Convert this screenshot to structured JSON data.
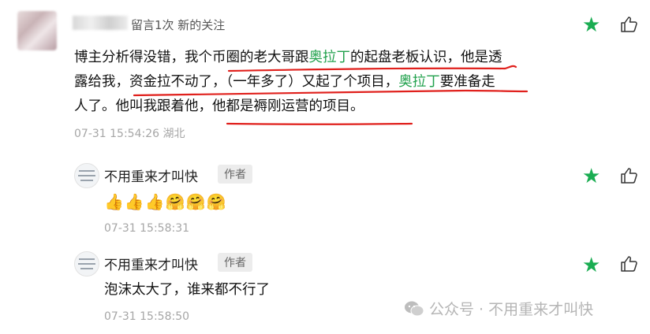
{
  "top_comment": {
    "meta": "留言1次 新的关注",
    "line1": [
      {
        "t": "博主分析得没错，我个币圈的老大哥跟",
        "c": "n"
      },
      {
        "t": "奥拉丁",
        "c": "g"
      },
      {
        "t": "的起盘老板认识，他是透",
        "c": "n"
      }
    ],
    "line2": [
      {
        "t": "露给我，资金拉不动了，（一年多了）又起了个项目，",
        "c": "n"
      },
      {
        "t": "奥拉丁",
        "c": "g"
      },
      {
        "t": "要准备走",
        "c": "n"
      }
    ],
    "line3": "人了。他叫我跟着他，他都是褥刚运营的项目。",
    "time": "07-31 15:54:26 湖北"
  },
  "replies": [
    {
      "name": "不用重来才叫快",
      "tag": "作者",
      "text": "👍👍👍🤗🤗🤗",
      "time": "07-31 15:58:31"
    },
    {
      "name": "不用重来才叫快",
      "tag": "作者",
      "text": "泡沫太大了，谁来都不行了",
      "time": "07-31 15:58:50"
    }
  ],
  "watermark": "公众号 · 不用重来才叫快",
  "icons": {
    "star": "star-icon",
    "like": "thumbs-up-icon",
    "wechat": "wechat-icon"
  },
  "colors": {
    "green": "#22a14d",
    "star": "#1aad52",
    "underline": "#e0201c"
  }
}
